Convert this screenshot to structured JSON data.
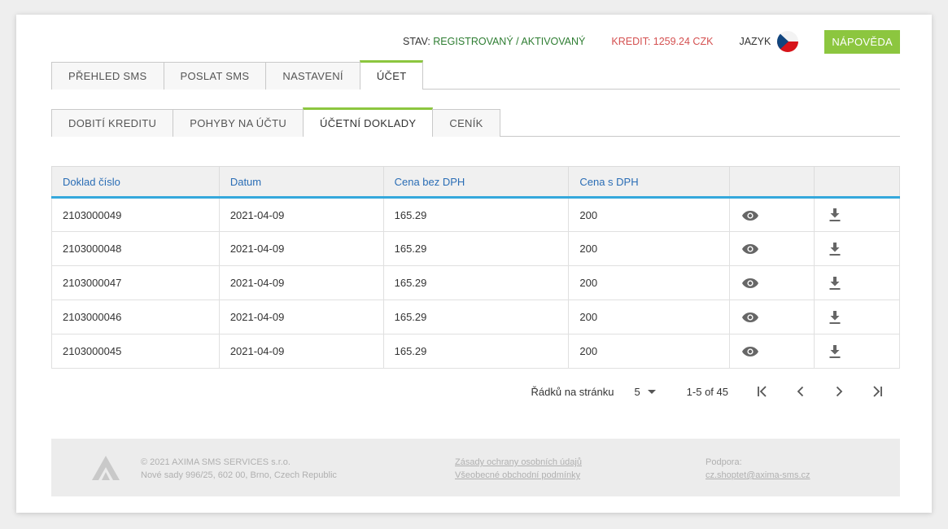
{
  "header": {
    "stav_label": "STAV:",
    "stav_value": "REGISTROVANÝ / AKTIVOVANÝ",
    "kredit": "KREDIT: 1259.24 CZK",
    "jazyk": "JAZYK",
    "help": "NÁPOVĚDA"
  },
  "main_tabs": [
    {
      "label": "PŘEHLED SMS",
      "active": false
    },
    {
      "label": "POSLAT SMS",
      "active": false
    },
    {
      "label": "NASTAVENÍ",
      "active": false
    },
    {
      "label": "ÚČET",
      "active": true
    }
  ],
  "sub_tabs": [
    {
      "label": "DOBITÍ KREDITU",
      "active": false
    },
    {
      "label": "POHYBY NA ÚČTU",
      "active": false
    },
    {
      "label": "ÚČETNÍ DOKLADY",
      "active": true
    },
    {
      "label": "CENÍK",
      "active": false
    }
  ],
  "table": {
    "columns": [
      "Doklad číslo",
      "Datum",
      "Cena bez DPH",
      "Cena s DPH",
      "",
      ""
    ],
    "rows": [
      {
        "doklad": "2103000049",
        "datum": "2021-04-09",
        "bez": "165.29",
        "s": "200"
      },
      {
        "doklad": "2103000048",
        "datum": "2021-04-09",
        "bez": "165.29",
        "s": "200"
      },
      {
        "doklad": "2103000047",
        "datum": "2021-04-09",
        "bez": "165.29",
        "s": "200"
      },
      {
        "doklad": "2103000046",
        "datum": "2021-04-09",
        "bez": "165.29",
        "s": "200"
      },
      {
        "doklad": "2103000045",
        "datum": "2021-04-09",
        "bez": "165.29",
        "s": "200"
      }
    ],
    "row_icons": [
      "eye-icon",
      "download-icon"
    ]
  },
  "pagination": {
    "rows_label": "Řádků na stránku",
    "rows_value": "5",
    "range": "1-5 of 45",
    "icons": [
      "first-page-icon",
      "prev-page-icon",
      "next-page-icon",
      "last-page-icon"
    ]
  },
  "footer": {
    "copyright": "© 2021 AXIMA SMS SERVICES s.r.o.",
    "address": "Nové sady 996/25, 602 00, Brno, Czech Republic",
    "privacy": "Zásady ochrany osobních údajů",
    "terms": "Všeobecné obchodní podmínky",
    "support_label": "Podpora:",
    "support_email": "cz.shoptet@axima-sms.cz"
  },
  "colors": {
    "accent_green": "#8cc63f",
    "header_blue": "#2a6db5",
    "table_line": "#35a8dc",
    "credit_red": "#d45050",
    "status_green": "#2e7d32"
  }
}
